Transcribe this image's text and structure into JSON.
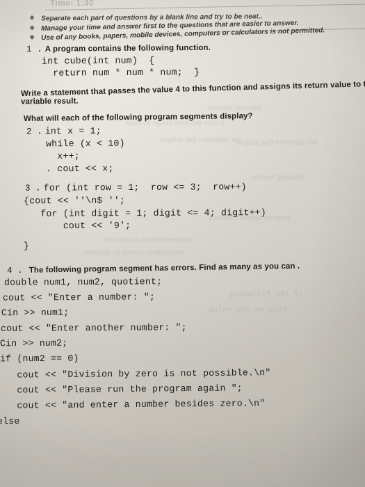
{
  "document": {
    "type": "exam-paper-photograph",
    "paper_color": "#cfcbc3",
    "ink_color": "#1e1d1b",
    "header_faded": "Time: 1:30"
  },
  "instructions": {
    "bullet_glyph": "❖",
    "items": [
      "Separate each part of questions by a blank line and try to be neat..",
      "Manage your time and answer first to the questions that are easier to answer.",
      "Use of any books, papers, mobile devices, computers or calculators is not permitted."
    ]
  },
  "questions": [
    {
      "number": "1 .",
      "prompt": "A program contains the following function.",
      "code": [
        "int cube(int num)  {",
        "  return num * num * num;  }"
      ],
      "followup": [
        "Write a statement that passes the value 4 to this function and assigns its return value to the",
        "variable result."
      ]
    },
    {
      "section_prompt": "What will each of the following program segments display?",
      "number": "2 .",
      "code": [
        "int x = 1;",
        " while (x < 10)",
        "   x++;",
        " . cout << x;"
      ]
    },
    {
      "number": "3 .",
      "code": [
        "for (int row = 1;  row <= 3;  row++)",
        "{cout << ''\\n$ '';",
        "   for (int digit = 1; digit <= 4; digit++)",
        "       cout << '9';",
        "}"
      ]
    },
    {
      "number": "4 .",
      "prompt": "The following program segment has errors. Find as many as you can .",
      "code": [
        "double num1, num2, quotient;",
        "cout << \"Enter a number: \";",
        "Cin >> num1;",
        "cout << \"Enter another number: \";",
        "Cin >> num2;",
        "if (num2 == 0)",
        "   cout << \"Division by zero is not possible.\\n\"",
        "   cout << \"Please run the program again \";",
        "   cout << \"and enter a number besides zero.\\n\"",
        "else"
      ]
    }
  ],
  "ghost_text": {
    "lines": [
      "following function",
      "a cube and then assign its value",
      "the statement that assigns",
      "implemented the function by",
      "temperature Celsius by and then",
      "program segment displays",
      "of the following",
      "returns the value"
    ]
  }
}
